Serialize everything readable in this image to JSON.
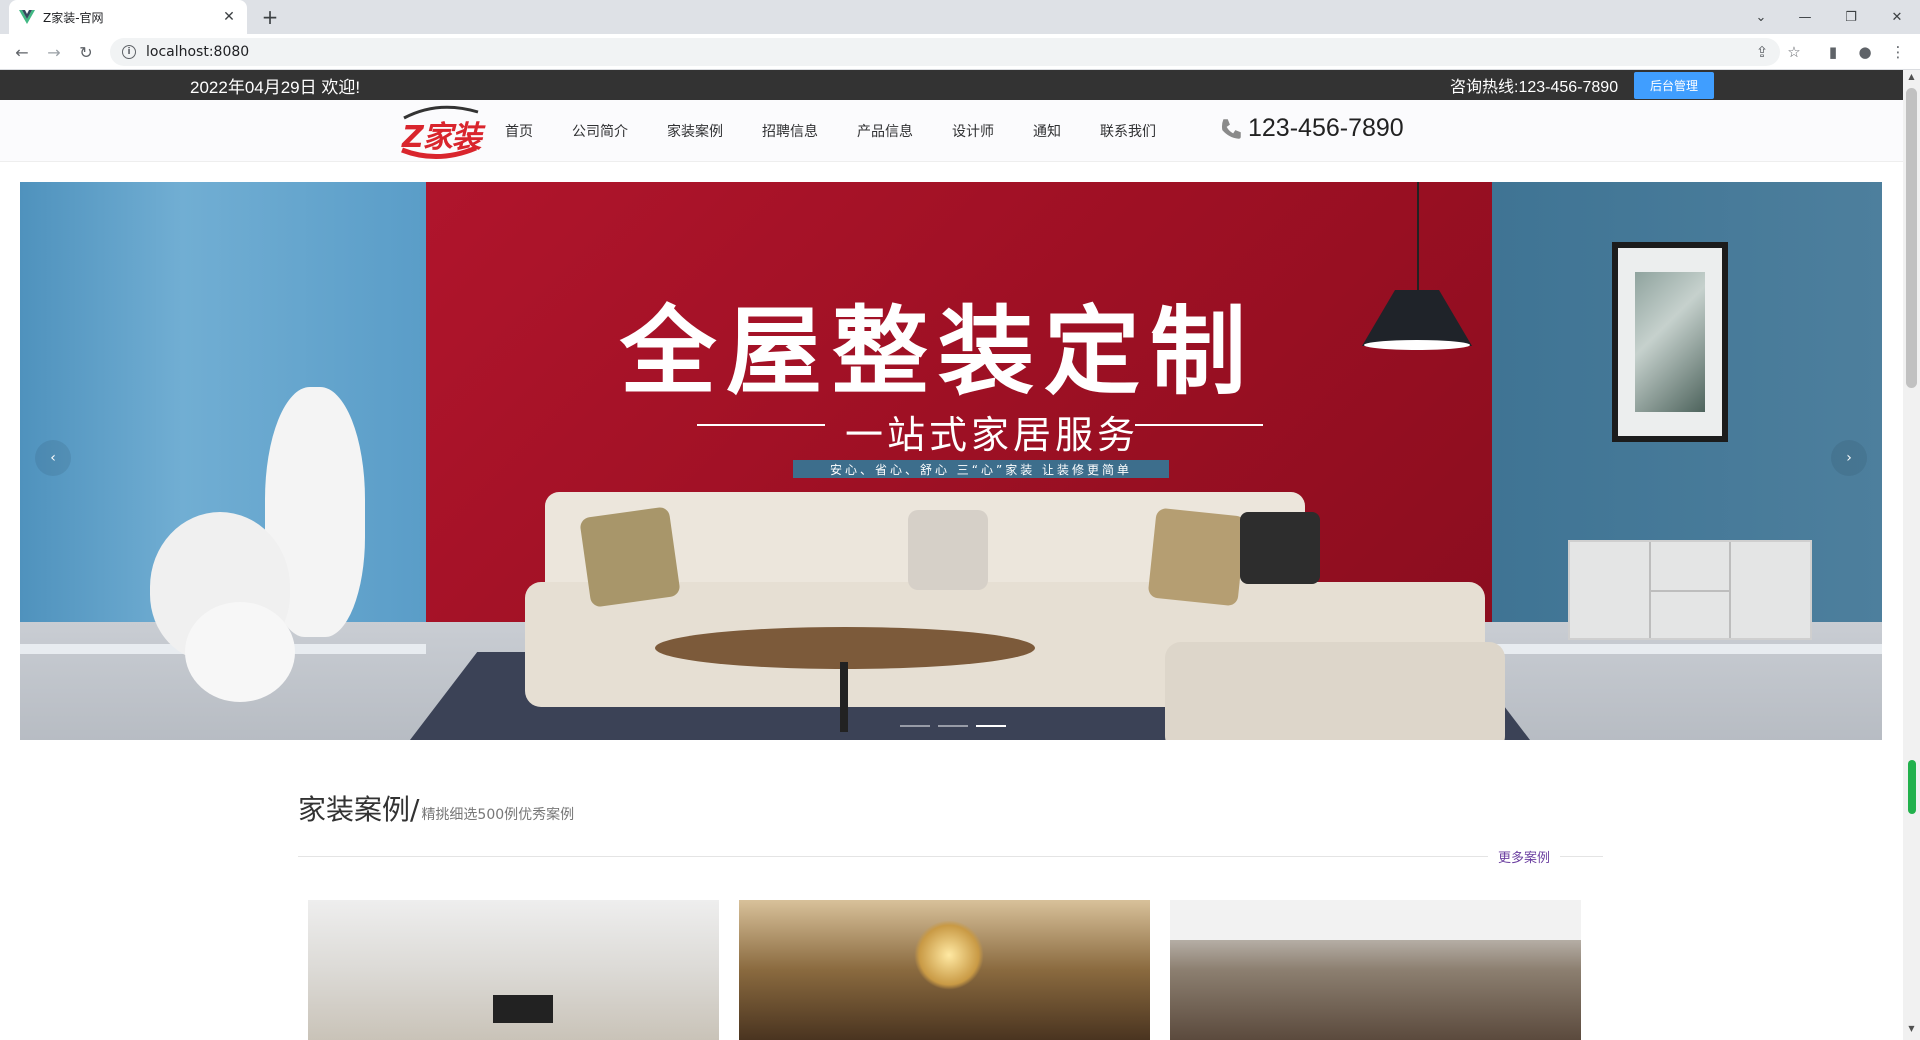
{
  "browser": {
    "tab_title": "Z家装-官网",
    "url": "localhost:8080"
  },
  "topbar": {
    "date": "2022年04月29日 欢迎!",
    "hotline": "咨询热线:123-456-7890",
    "admin_button": "后台管理"
  },
  "header": {
    "logo_text": "Z家装",
    "nav": [
      "首页",
      "公司简介",
      "家装案例",
      "招聘信息",
      "产品信息",
      "设计师",
      "通知",
      "联系我们"
    ],
    "phone": "123-456-7890"
  },
  "banner": {
    "title": "全屋整装定制",
    "subtitle": "一站式家居服务",
    "tagline": "安心、省心、舒心 三“心”家装 让装修更简单",
    "slide_count": 3,
    "active_slide": 3
  },
  "section": {
    "title": "家装案例/",
    "subtitle": "精挑细选500例优秀案例",
    "more": "更多案例"
  },
  "colors": {
    "topbar_bg": "#333333",
    "admin_button_bg": "#409eff",
    "more_link": "#6b3fa0",
    "logo_red": "#d9252d"
  }
}
